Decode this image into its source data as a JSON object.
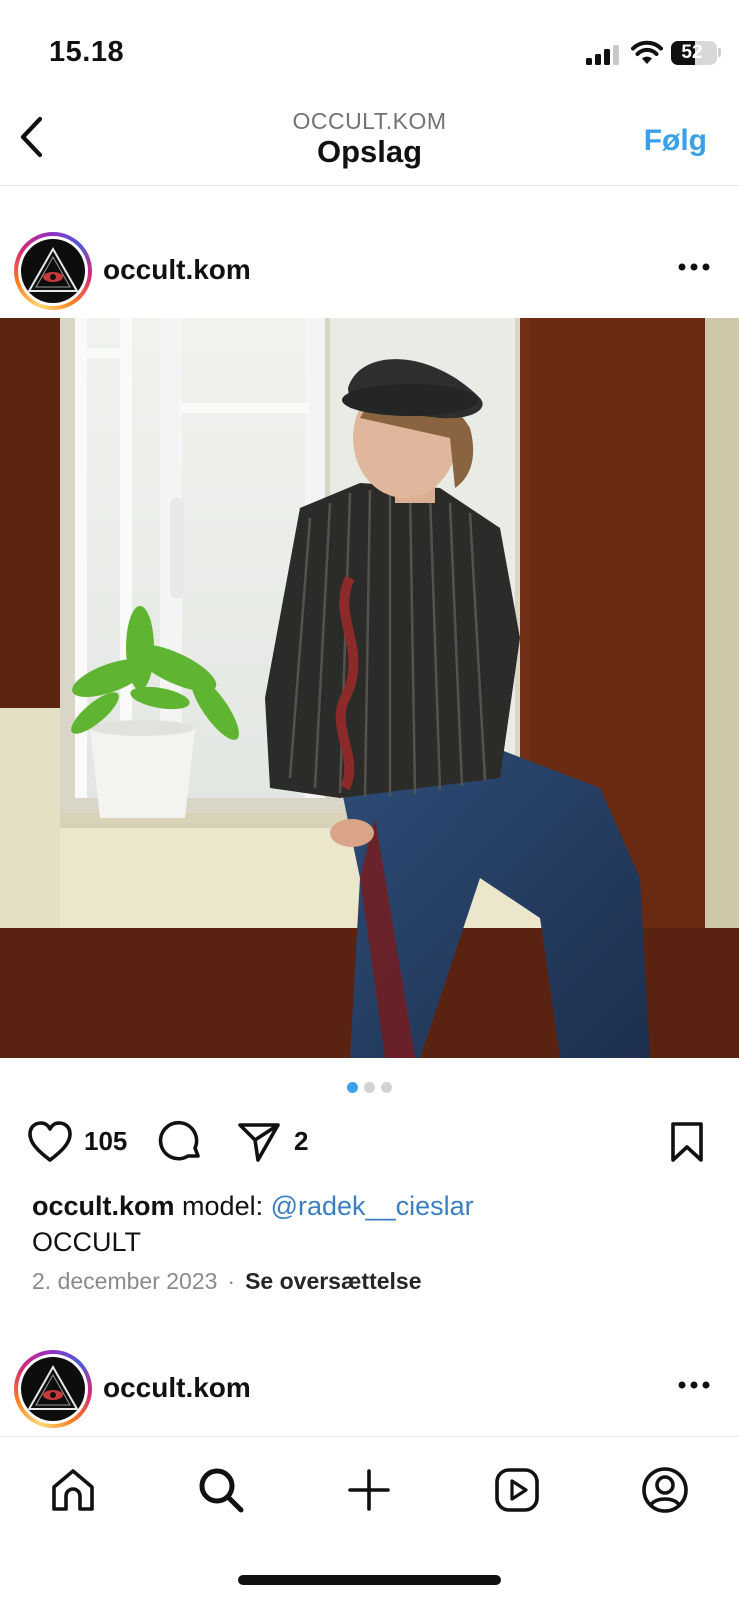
{
  "status": {
    "time": "15.18",
    "battery": "52",
    "battery_level": 0.52
  },
  "header": {
    "subtitle": "OCCULT.KOM",
    "title": "Opslag",
    "follow_label": "Følg"
  },
  "post": {
    "username": "occult.kom",
    "likes": "105",
    "shares": "2",
    "carousel": {
      "count": 3,
      "active": 1
    },
    "caption": {
      "username": "occult.kom",
      "text": "model:",
      "mention": "@radek__cieslar",
      "second_line": "OCCULT"
    },
    "date": "2. december 2023",
    "separator": "·",
    "translate_label": "Se oversættelse"
  },
  "next_post": {
    "username": "occult.kom"
  },
  "icons": {
    "back": "chevron-left-icon",
    "more": "more-horizontal-icon",
    "like": "heart-icon",
    "comment": "comment-icon",
    "share": "send-icon",
    "save": "bookmark-icon",
    "nav": [
      "home-icon",
      "search-icon",
      "plus-icon",
      "reels-icon",
      "profile-icon"
    ]
  },
  "colors": {
    "accent": "#3aa0e8",
    "mention": "#3a7fc1",
    "muted": "#8a8a8a"
  }
}
